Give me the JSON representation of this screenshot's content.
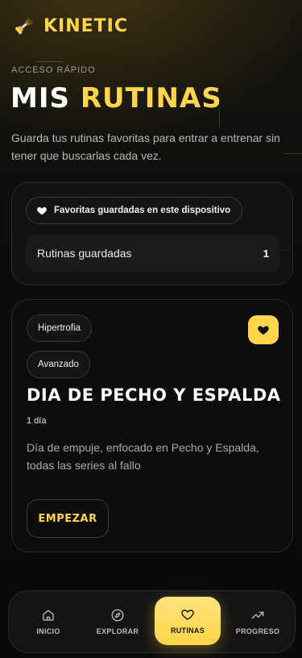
{
  "brand": {
    "name": "KINETIC",
    "logo_icon": "dumbbell-icon",
    "accent": "#ffd54a"
  },
  "header": {
    "eyebrow": "ACCESO RÁPIDO",
    "title_part1": "MIS",
    "title_part2": "RUTINAS",
    "subtitle": "Guarda tus rutinas favoritas para entrar a entrenar sin tener que buscarlas cada vez."
  },
  "favorites": {
    "pill_label": "Favoritas guardadas en este dispositivo",
    "pill_icon": "heart-icon",
    "saved_label": "Rutinas guardadas",
    "saved_count": "1"
  },
  "routine": {
    "tags": [
      "Hipertrofia",
      "Avanzado"
    ],
    "title": "DIA DE PECHO Y ESPALDA",
    "days": "1 día",
    "description": "Día de empuje, enfocado en Pecho y Espalda, todas las series al fallo",
    "start_label": "EMPEZAR",
    "favorite_icon": "heart-filled-icon"
  },
  "nav": {
    "items": [
      {
        "label": "INICIO",
        "icon": "home-icon",
        "active": false
      },
      {
        "label": "EXPLORAR",
        "icon": "compass-icon",
        "active": false
      },
      {
        "label": "RUTINAS",
        "icon": "heart-icon",
        "active": true
      },
      {
        "label": "PROGRESO",
        "icon": "trending-up-icon",
        "active": false
      }
    ]
  }
}
